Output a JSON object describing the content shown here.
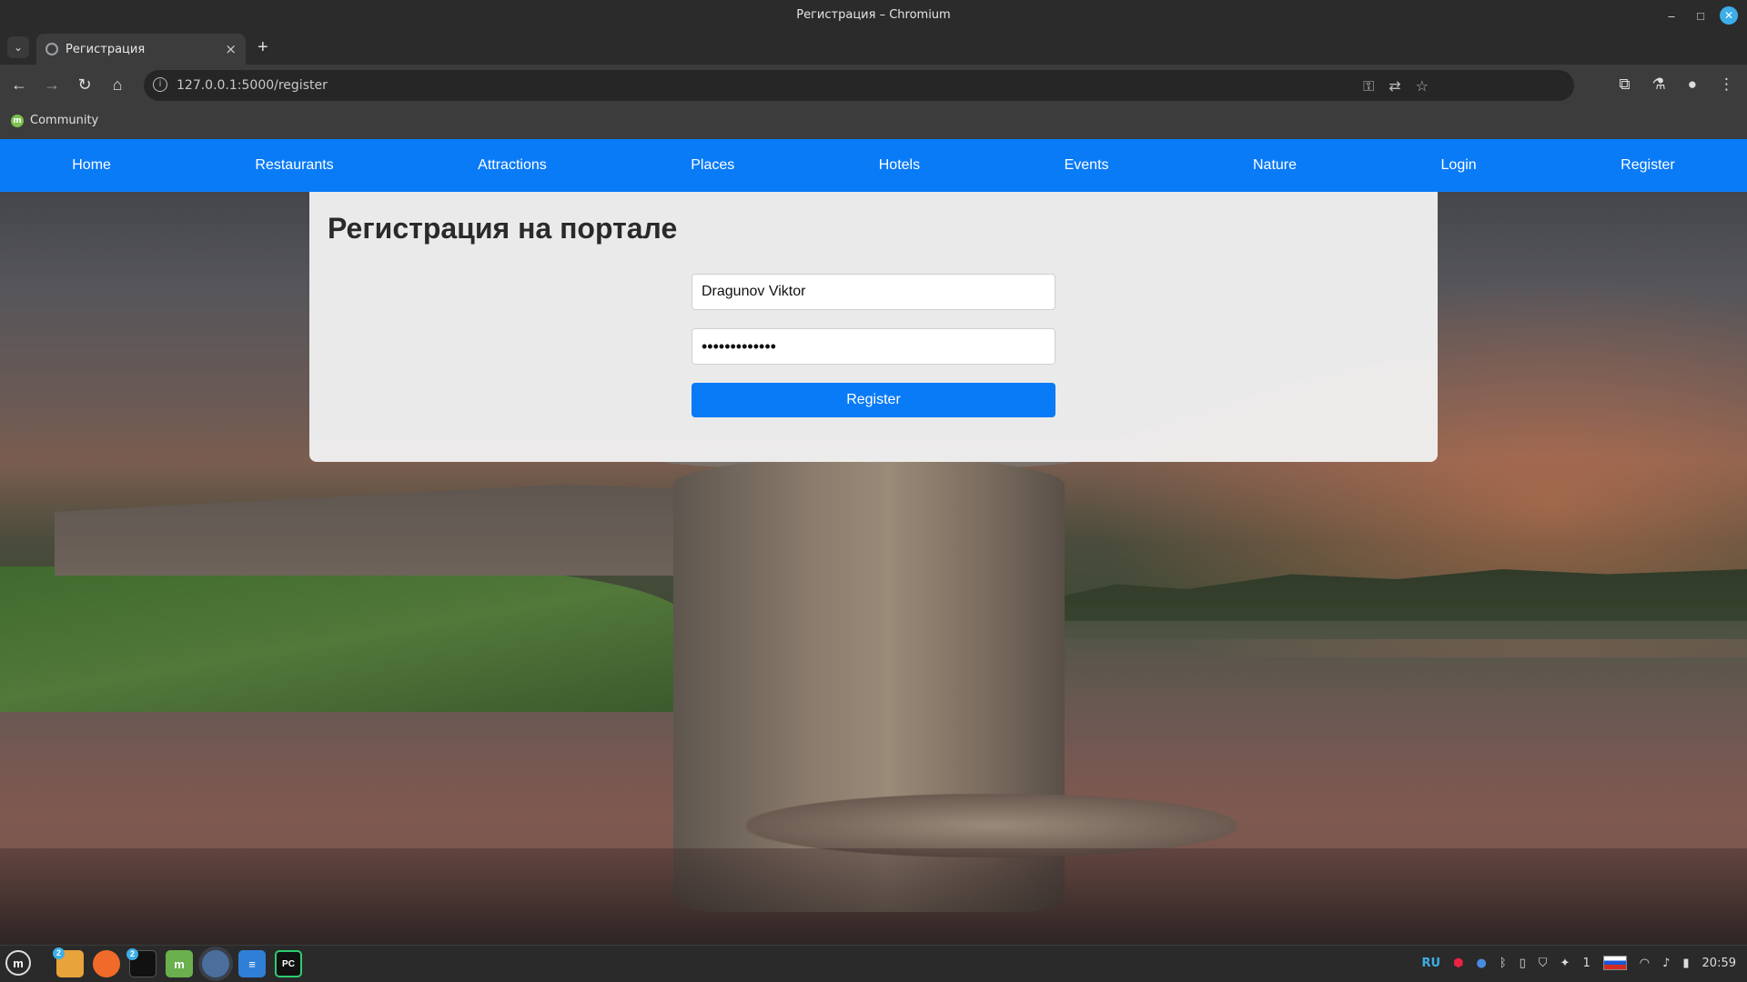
{
  "window": {
    "title": "Регистрация – Chromium",
    "controls": {
      "minimize": "–",
      "maximize": "□",
      "close": "✕"
    }
  },
  "tabs": [
    {
      "label": "Регистрация",
      "close": "×"
    }
  ],
  "newtab": "+",
  "toolbar": {
    "url": "127.0.0.1:5000/register",
    "icons": [
      "back-icon",
      "forward-icon",
      "reload-icon",
      "home-icon",
      "key-icon",
      "translate-icon",
      "star-icon",
      "extensions-icon",
      "labs-icon",
      "profile-icon",
      "menu-icon"
    ]
  },
  "bookmarks": [
    {
      "label": "Community",
      "icon": "m"
    }
  ],
  "site_nav": {
    "items": [
      "Home",
      "Restaurants",
      "Attractions",
      "Places",
      "Hotels",
      "Events",
      "Nature",
      "Login",
      "Register"
    ]
  },
  "form": {
    "title": "Регистрация на портале",
    "username_value": "Dragunov Viktor",
    "password_value": "•••••••••••••",
    "submit_label": "Register"
  },
  "taskbar": {
    "badges": {
      "files": "2",
      "terminal": "2"
    },
    "pycharm_label": "PC",
    "mint_label": "m",
    "language": "RU",
    "workspace": "1",
    "clock": "20:59"
  },
  "colors": {
    "accent": "#0a7bf7",
    "chrome_dark": "#2b2b2b",
    "toolbar": "#3c3c3c"
  }
}
